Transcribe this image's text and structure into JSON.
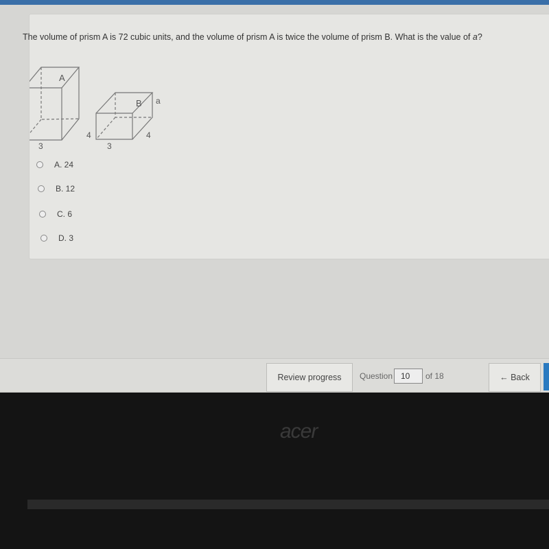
{
  "question": {
    "text": "The volume of prism A is 72 cubic units, and the volume of prism A is twice the volume of prism B. What is the value of ",
    "variable": "a",
    "end": "?"
  },
  "figure": {
    "prism_a": {
      "label": "A",
      "width": "3",
      "depth": "4"
    },
    "prism_b": {
      "label": "B",
      "width": "3",
      "depth": "4",
      "height": "a"
    }
  },
  "choices": [
    {
      "label": "A. 24"
    },
    {
      "label": "B. 12"
    },
    {
      "label": "C. 6"
    },
    {
      "label": "D. 3"
    }
  ],
  "footer": {
    "review_label": "Review progress",
    "question_label": "Question",
    "current": "10",
    "total_label": "of 18",
    "back_label": "← Back"
  },
  "brand": {
    "logo": "acer"
  },
  "colors": {
    "accent": "#2a7ac0",
    "topbar": "#3a6fa8"
  }
}
